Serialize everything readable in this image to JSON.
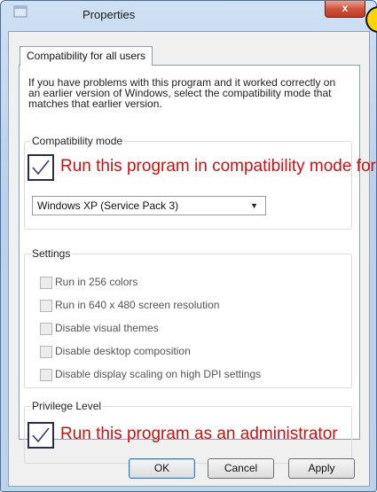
{
  "window": {
    "title": "Properties",
    "close_label": "x"
  },
  "tabs": [
    {
      "label": "Compatibility for all users"
    }
  ],
  "intro_text": "If you have problems with this program and it worked correctly on an earlier version of Windows, select the compatibility mode that matches that earlier version.",
  "compatibility": {
    "group_label": "Compatibility mode",
    "checkbox_label": "Run this program in compatibility mode for :",
    "checked": true,
    "selected_os": "Windows XP (Service Pack 3)"
  },
  "settings": {
    "group_label": "Settings",
    "options": [
      {
        "label": "Run in 256 colors",
        "checked": false
      },
      {
        "label": "Run in 640 x 480 screen resolution",
        "checked": false
      },
      {
        "label": "Disable visual themes",
        "checked": false
      },
      {
        "label": "Disable desktop composition",
        "checked": false
      },
      {
        "label": "Disable display scaling on high DPI settings",
        "checked": false
      }
    ]
  },
  "privilege": {
    "group_label": "Privilege Level",
    "checkbox_label": "Run this program as an administrator",
    "checked": true
  },
  "buttons": {
    "ok": "OK",
    "cancel": "Cancel",
    "apply": "Apply"
  },
  "colors": {
    "annotation_red": "#cc1010",
    "accent_yellow": "#ffd400"
  }
}
